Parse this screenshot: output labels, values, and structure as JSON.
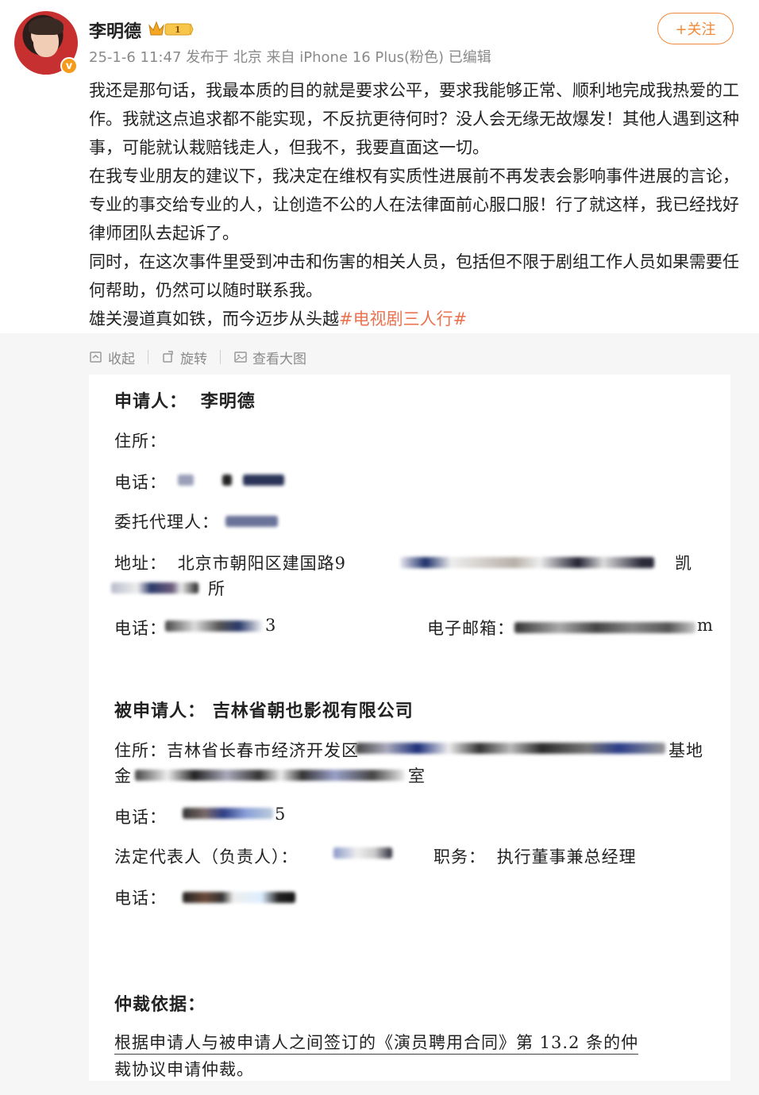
{
  "header": {
    "user_name": "李明德",
    "meta": "25-1-6 11:47  发布于 北京  来自 iPhone 16 Plus(粉色)  已编辑",
    "follow_label": "+关注",
    "verified_badge": "v"
  },
  "post": {
    "paragraphs": [
      "我还是那句话，我最本质的目的就是要求公平，要求我能够正常、顺利地完成我热爱的工作。我就这点追求都不能实现，不反抗更待何时？没人会无缘无故爆发！其他人遇到这种事，可能就认栽赔钱走人，但我不，我要直面这一切。",
      "在我专业朋友的建议下，我决定在维权有实质性进展前不再发表会影响事件进展的言论，专业的事交给专业的人，让创造不公的人在法律面前心服口服！行了就这样，我已经找好律师团队去起诉了。",
      "同时，在这次事件里受到冲击和伤害的相关人员，包括但不限于剧组工作人员如果需要任何帮助，仍然可以随时联系我。"
    ],
    "last_line_text": "雄关漫道真如铁，而今迈步从头越",
    "hashtag": "#电视剧三人行#"
  },
  "image_actions": {
    "collapse": "收起",
    "rotate": "旋转",
    "view_large": "查看大图"
  },
  "document": {
    "applicant_label": "申请人：",
    "applicant_name": "李明德",
    "residence_label": "住所：",
    "phone_label": "电话：",
    "agent_label": "委托代理人：",
    "address_label": "地址：",
    "address_value": "北京市朝阳区建国路9",
    "address_end": "凯",
    "address_line2_end": "所",
    "phone2_label": "电话：",
    "phone2_end": "3",
    "email_label": "电子邮箱：",
    "email_end": "m",
    "respondent_label": "被申请人：",
    "respondent_name": "吉林省朝也影视有限公司",
    "respondent_residence": "住所：吉林省长春市经济开发区",
    "respondent_residence_end": "基地",
    "respondent_residence_line2": "金",
    "respondent_residence_line2_end": "室",
    "respondent_phone_label": "电话：",
    "respondent_phone_end": "5",
    "legal_rep_label": "法定代表人（负责人）：",
    "position_label": "职务：",
    "position_value": "执行董事兼总经理",
    "legal_phone_label": "电话：",
    "basis_label": "仲裁依据：",
    "basis_line1": "根据申请人与被申请人之间签订的《演员聘用合同》第 13.2 条的仲",
    "basis_line2": "裁协议申请仲裁。"
  }
}
